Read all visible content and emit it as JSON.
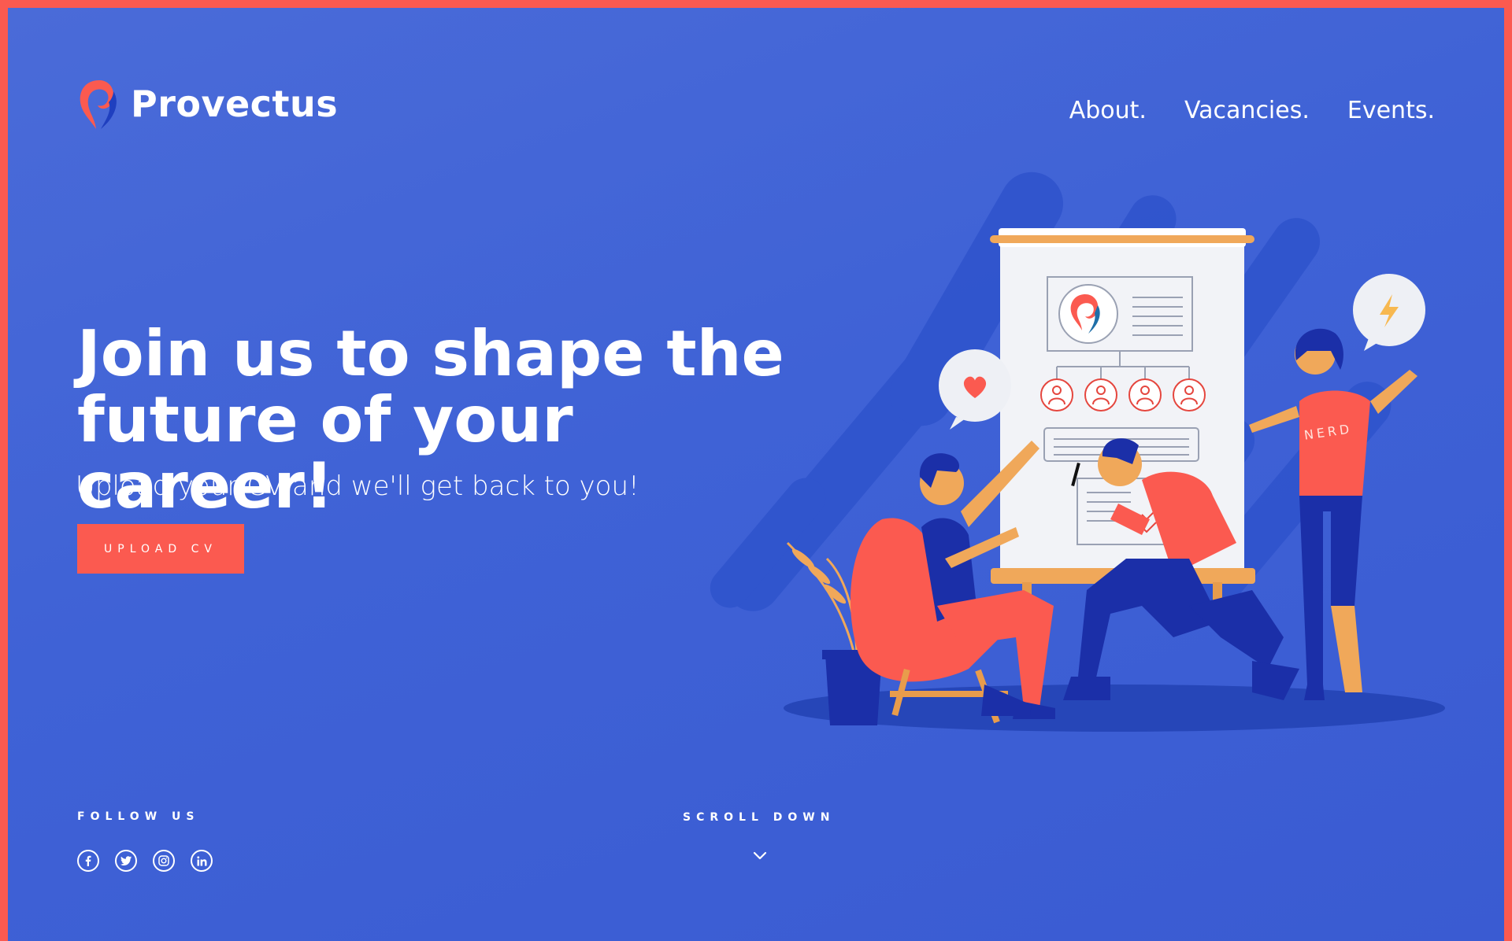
{
  "brand": {
    "name": "Provectus"
  },
  "nav": {
    "items": [
      "About.",
      "Vacancies.",
      "Events."
    ]
  },
  "hero": {
    "title_line1": "Join us to shape the",
    "title_line2": "future of your career!",
    "subtitle": "Upload your CV and we'll get back to you!",
    "cta_label": "UPLOAD CV"
  },
  "social": {
    "label": "FOLLOW US",
    "icons": [
      "facebook-icon",
      "twitter-icon",
      "instagram-icon",
      "linkedin-icon"
    ]
  },
  "scroll": {
    "label": "SCROLL DOWN"
  },
  "illustration": {
    "badge_text": "NERD"
  },
  "colors": {
    "accent": "#fb5a50",
    "background": "#4165d8",
    "text": "#ffffff"
  }
}
